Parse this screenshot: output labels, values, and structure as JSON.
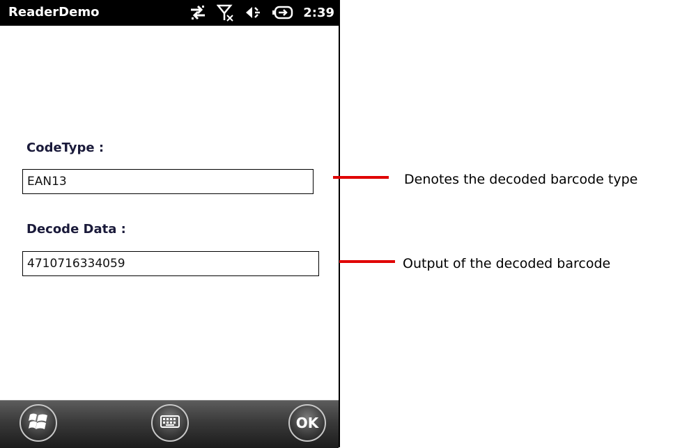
{
  "statusbar": {
    "app_title": "ReaderDemo",
    "time": "2:39",
    "icons": [
      "data-sync-icon",
      "signal-off-icon",
      "speaker-icon",
      "battery-charging-icon"
    ]
  },
  "form": {
    "code_type_label": "CodeType :",
    "code_type_value": "EAN13",
    "decode_data_label": "Decode Data :",
    "decode_data_value": "4710716334059"
  },
  "taskbar": {
    "start_icon": "windows-start-icon",
    "keyboard_icon": "keyboard-icon",
    "ok_label": "OK"
  },
  "annotations": {
    "code_type_note": "Denotes the decoded barcode type",
    "decode_data_note": "Output of the decoded barcode",
    "line_color": "#e00000"
  }
}
